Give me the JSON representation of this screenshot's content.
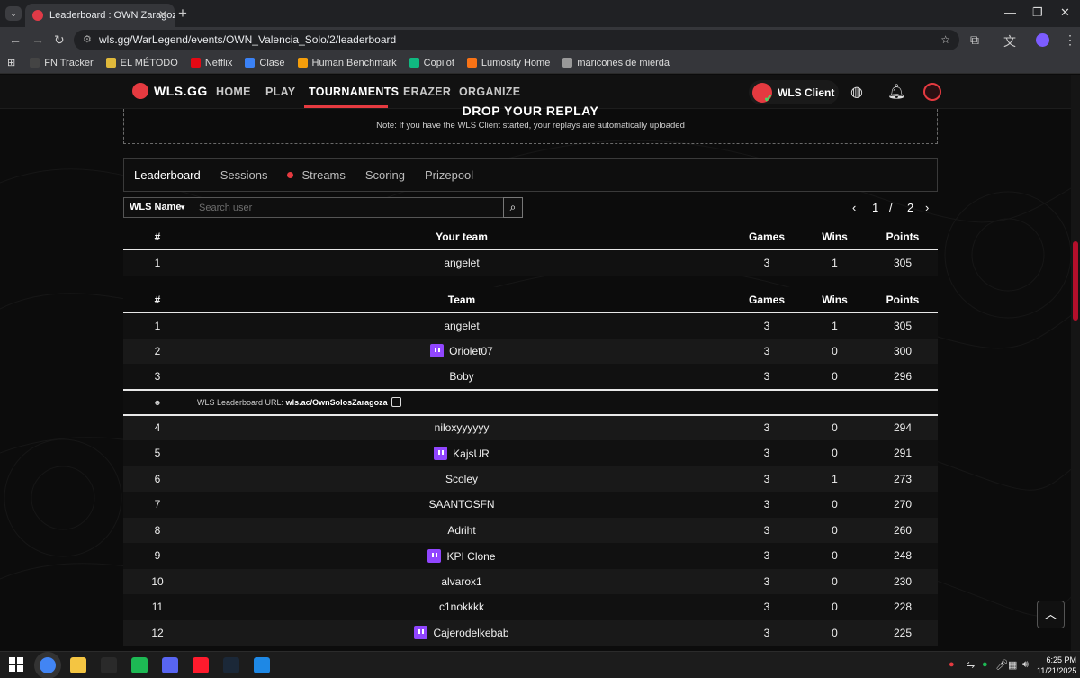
{
  "browser": {
    "tab_title": "Leaderboard : OWN Zaragoza S",
    "url": "wls.gg/WarLegend/events/OWN_Valencia_Solo/2/leaderboard",
    "bookmarks": [
      {
        "label": "FN Tracker",
        "color": "#444444"
      },
      {
        "label": "EL MÉTODO",
        "color": "#e0b93b"
      },
      {
        "label": "Netflix",
        "color": "#e50914"
      },
      {
        "label": "Clase",
        "color": "#3b82f6"
      },
      {
        "label": "Human Benchmark",
        "color": "#f59e0b"
      },
      {
        "label": "Copilot",
        "color": "#10b981"
      },
      {
        "label": "Lumosity Home",
        "color": "#f97316"
      },
      {
        "label": "maricones de mierda",
        "color": "#999999"
      }
    ]
  },
  "site": {
    "brand": "WLS.GG",
    "nav": [
      "HOME",
      "PLAY",
      "TOURNAMENTS",
      "ERAZER",
      "ORGANIZE"
    ],
    "active_nav": "TOURNAMENTS",
    "client_label": "WLS Client",
    "accent": "#e53a40"
  },
  "drop": {
    "heading": "DROP YOUR REPLAY",
    "note": "Note: If you have the WLS Client started, your replays are automatically uploaded"
  },
  "subtabs": [
    "Leaderboard",
    "Sessions",
    "Streams",
    "Scoring",
    "Prizepool"
  ],
  "filter": {
    "dropdown_label": "WLS Name",
    "search_placeholder": "Search user"
  },
  "pager": {
    "current": "1",
    "separator": "/",
    "total": "2"
  },
  "your_team": {
    "headers": [
      "#",
      "Your team",
      "Games",
      "Wins",
      "Points"
    ],
    "row": {
      "rank": "1",
      "team": "angelet",
      "games": "3",
      "wins": "1",
      "points": "305"
    }
  },
  "leaderboard": {
    "headers": [
      "#",
      "Team",
      "Games",
      "Wins",
      "Points"
    ],
    "url_label": "WLS Leaderboard URL:",
    "url_value": "wls.ac/OwnSolosZaragoza",
    "rows": [
      {
        "rank": "1",
        "team": "angelet",
        "games": "3",
        "wins": "1",
        "points": "305",
        "twitch": false
      },
      {
        "rank": "2",
        "team": "Oriolet07",
        "games": "3",
        "wins": "0",
        "points": "300",
        "twitch": true
      },
      {
        "rank": "3",
        "team": "Boby",
        "games": "3",
        "wins": "0",
        "points": "296",
        "twitch": false
      },
      {
        "rank": "4",
        "team": "niloxyyyyyy",
        "games": "3",
        "wins": "0",
        "points": "294",
        "twitch": false
      },
      {
        "rank": "5",
        "team": "KajsUR",
        "games": "3",
        "wins": "0",
        "points": "291",
        "twitch": true
      },
      {
        "rank": "6",
        "team": "Scoley",
        "games": "3",
        "wins": "1",
        "points": "273",
        "twitch": false
      },
      {
        "rank": "7",
        "team": "SAANTOSFN",
        "games": "3",
        "wins": "0",
        "points": "270",
        "twitch": false
      },
      {
        "rank": "8",
        "team": "Adriht",
        "games": "3",
        "wins": "0",
        "points": "260",
        "twitch": false
      },
      {
        "rank": "9",
        "team": "KPI Clone",
        "games": "3",
        "wins": "0",
        "points": "248",
        "twitch": true
      },
      {
        "rank": "10",
        "team": "alvarox1",
        "games": "3",
        "wins": "0",
        "points": "230",
        "twitch": false
      },
      {
        "rank": "11",
        "team": "c1nokkkk",
        "games": "3",
        "wins": "0",
        "points": "228",
        "twitch": false
      },
      {
        "rank": "12",
        "team": "Cajerodelkebab",
        "games": "3",
        "wins": "0",
        "points": "225",
        "twitch": true
      }
    ]
  },
  "taskbar": {
    "time": "6:25 PM",
    "date": "11/21/2025",
    "apps": [
      {
        "name": "chrome",
        "color": "#4285f4"
      },
      {
        "name": "file-explorer",
        "color": "#f4c542"
      },
      {
        "name": "epic-games",
        "color": "#2a2a2a"
      },
      {
        "name": "spotify",
        "color": "#1db954"
      },
      {
        "name": "discord",
        "color": "#5865f2"
      },
      {
        "name": "opera",
        "color": "#ff1b2d"
      },
      {
        "name": "steam",
        "color": "#1b2838"
      },
      {
        "name": "fortnite",
        "color": "#1e88e5"
      }
    ]
  }
}
